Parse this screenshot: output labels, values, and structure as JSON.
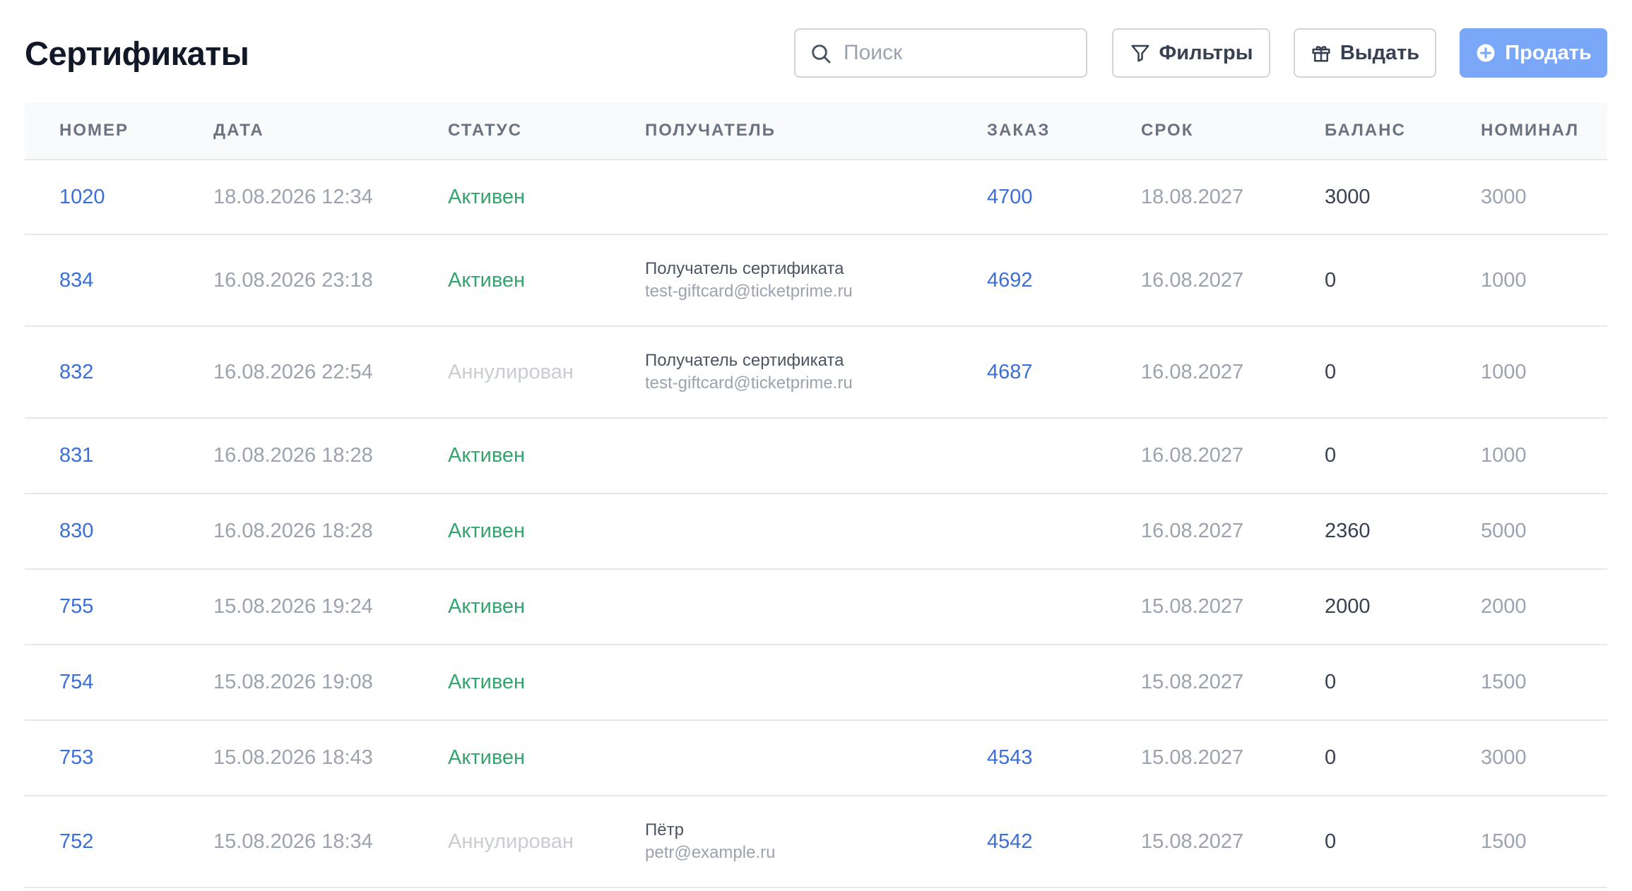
{
  "page": {
    "title": "Сертификаты"
  },
  "toolbar": {
    "search_placeholder": "Поиск",
    "search_value": "",
    "filters_label": "Фильтры",
    "issue_label": "Выдать",
    "sell_label": "Продать"
  },
  "colors": {
    "accent": "#7aa7f7",
    "link": "#3b6fd8",
    "status_active": "#34a56f",
    "status_void": "#c9cdd3"
  },
  "table": {
    "columns": [
      "Номер",
      "Дата",
      "Статус",
      "Получатель",
      "Заказ",
      "Срок",
      "Баланс",
      "Номинал"
    ],
    "rows": [
      {
        "number": "1020",
        "date": "18.08.2026 12:34",
        "status": "Активен",
        "status_kind": "active",
        "recipient_name": "",
        "recipient_email": "",
        "order": "4700",
        "term": "18.08.2027",
        "balance": "3000",
        "nominal": "3000"
      },
      {
        "number": "834",
        "date": "16.08.2026 23:18",
        "status": "Активен",
        "status_kind": "active",
        "recipient_name": "Получатель сертификата",
        "recipient_email": "test-giftcard@ticketprime.ru",
        "order": "4692",
        "term": "16.08.2027",
        "balance": "0",
        "nominal": "1000"
      },
      {
        "number": "832",
        "date": "16.08.2026 22:54",
        "status": "Аннулирован",
        "status_kind": "void",
        "recipient_name": "Получатель сертификата",
        "recipient_email": "test-giftcard@ticketprime.ru",
        "order": "4687",
        "term": "16.08.2027",
        "balance": "0",
        "nominal": "1000"
      },
      {
        "number": "831",
        "date": "16.08.2026 18:28",
        "status": "Активен",
        "status_kind": "active",
        "recipient_name": "",
        "recipient_email": "",
        "order": "",
        "term": "16.08.2027",
        "balance": "0",
        "nominal": "1000"
      },
      {
        "number": "830",
        "date": "16.08.2026 18:28",
        "status": "Активен",
        "status_kind": "active",
        "recipient_name": "",
        "recipient_email": "",
        "order": "",
        "term": "16.08.2027",
        "balance": "2360",
        "nominal": "5000"
      },
      {
        "number": "755",
        "date": "15.08.2026 19:24",
        "status": "Активен",
        "status_kind": "active",
        "recipient_name": "",
        "recipient_email": "",
        "order": "",
        "term": "15.08.2027",
        "balance": "2000",
        "nominal": "2000"
      },
      {
        "number": "754",
        "date": "15.08.2026 19:08",
        "status": "Активен",
        "status_kind": "active",
        "recipient_name": "",
        "recipient_email": "",
        "order": "",
        "term": "15.08.2027",
        "balance": "0",
        "nominal": "1500"
      },
      {
        "number": "753",
        "date": "15.08.2026 18:43",
        "status": "Активен",
        "status_kind": "active",
        "recipient_name": "",
        "recipient_email": "",
        "order": "4543",
        "term": "15.08.2027",
        "balance": "0",
        "nominal": "3000"
      },
      {
        "number": "752",
        "date": "15.08.2026 18:34",
        "status": "Аннулирован",
        "status_kind": "void",
        "recipient_name": "Пётр",
        "recipient_email": "petr@example.ru",
        "order": "4542",
        "term": "15.08.2027",
        "balance": "0",
        "nominal": "1500"
      }
    ]
  },
  "icons": {
    "search": "search-icon",
    "filter": "filter-icon",
    "gift": "gift-icon",
    "plus": "plus-circle-icon"
  }
}
